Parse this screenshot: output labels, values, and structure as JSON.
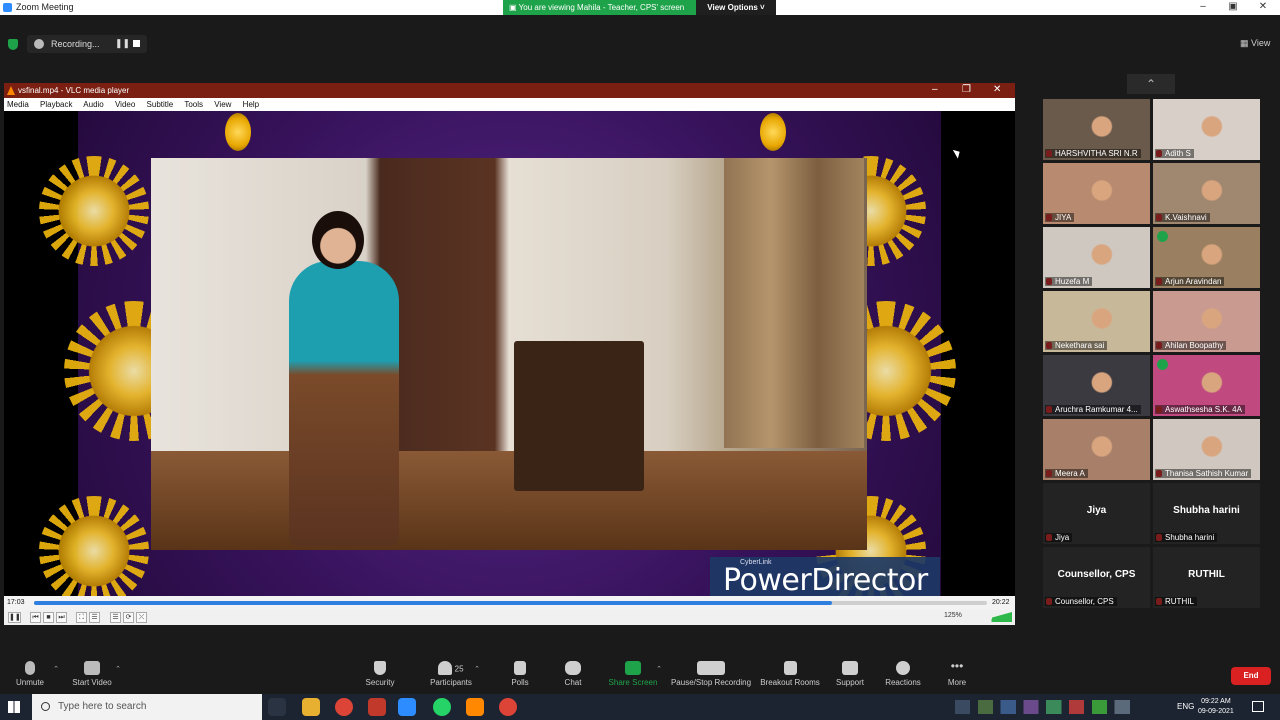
{
  "window": {
    "title": "Zoom Meeting"
  },
  "banner": {
    "viewing": "You are viewing Mahila - Teacher, CPS' screen",
    "view_options": "View Options ˅"
  },
  "recording": {
    "label": "Recording...",
    "pause_icon": "pause-icon",
    "stop_icon": "stop-icon"
  },
  "view_button": "View",
  "vlc": {
    "title": "vsfinal.mp4 - VLC media player",
    "menu": [
      "Media",
      "Playback",
      "Audio",
      "Video",
      "Subtitle",
      "Tools",
      "View",
      "Help"
    ],
    "time_elapsed": "17:03",
    "time_total": "20:22",
    "progress_fraction": 0.837,
    "volume": "125%",
    "watermark_small": "CyberLink",
    "watermark": "PowerDirector"
  },
  "gallery": {
    "tiles": [
      {
        "name": "HARSHVITHA SRI N.R",
        "color": "#6a5a4c",
        "check": false,
        "big": ""
      },
      {
        "name": "Adith S",
        "color": "#d8cfc8",
        "check": false,
        "big": ""
      },
      {
        "name": "JIYA",
        "color": "#b88a70",
        "check": false,
        "big": ""
      },
      {
        "name": "K.Vaishnavi",
        "color": "#a08870",
        "check": false,
        "big": ""
      },
      {
        "name": "Huzefa M",
        "color": "#cfc8c0",
        "check": false,
        "big": ""
      },
      {
        "name": "Arjun Aravindan",
        "color": "#9a8060",
        "check": true,
        "big": ""
      },
      {
        "name": "Nekethara  sai",
        "color": "#c8b89a",
        "check": false,
        "big": ""
      },
      {
        "name": "Ahilan Boopathy",
        "color": "#c89a90",
        "check": false,
        "big": ""
      },
      {
        "name": "Aruchra Ramkumar 4...",
        "color": "#3a3a40",
        "check": false,
        "big": ""
      },
      {
        "name": "Aswathsesha S.K. 4A",
        "color": "#c04a80",
        "check": true,
        "big": ""
      },
      {
        "name": "Meera A",
        "color": "#a8806a",
        "check": false,
        "big": ""
      },
      {
        "name": "Thanisa Sathish Kumar",
        "color": "#d0c8c0",
        "check": false,
        "big": ""
      },
      {
        "name": "Jiya",
        "color": "#232323",
        "check": false,
        "big": "Jiya"
      },
      {
        "name": "Shubha harini",
        "color": "#232323",
        "check": false,
        "big": "Shubha harini"
      },
      {
        "name": "Counsellor, CPS",
        "color": "#232323",
        "check": false,
        "big": "Counsellor, CPS"
      },
      {
        "name": "RUTHIL",
        "color": "#232323",
        "check": false,
        "big": "RUTHIL"
      }
    ]
  },
  "toolbar": {
    "unmute": "Unmute",
    "start_video": "Start Video",
    "security": "Security",
    "participants": "Participants",
    "participants_count": "25",
    "polls": "Polls",
    "chat": "Chat",
    "share_screen": "Share Screen",
    "recording": "Pause/Stop Recording",
    "breakout": "Breakout Rooms",
    "support": "Support",
    "reactions": "Reactions",
    "more": "More",
    "end": "End"
  },
  "taskbar": {
    "search_placeholder": "Type here to search",
    "lang": "ENG",
    "time": "09:22 AM",
    "date": "09-09-2021"
  },
  "colors": {
    "zoom_green": "#1ea34a",
    "end_red": "#d92121",
    "vlc_title": "#7a1f12",
    "share_green": "#1ea34a"
  }
}
